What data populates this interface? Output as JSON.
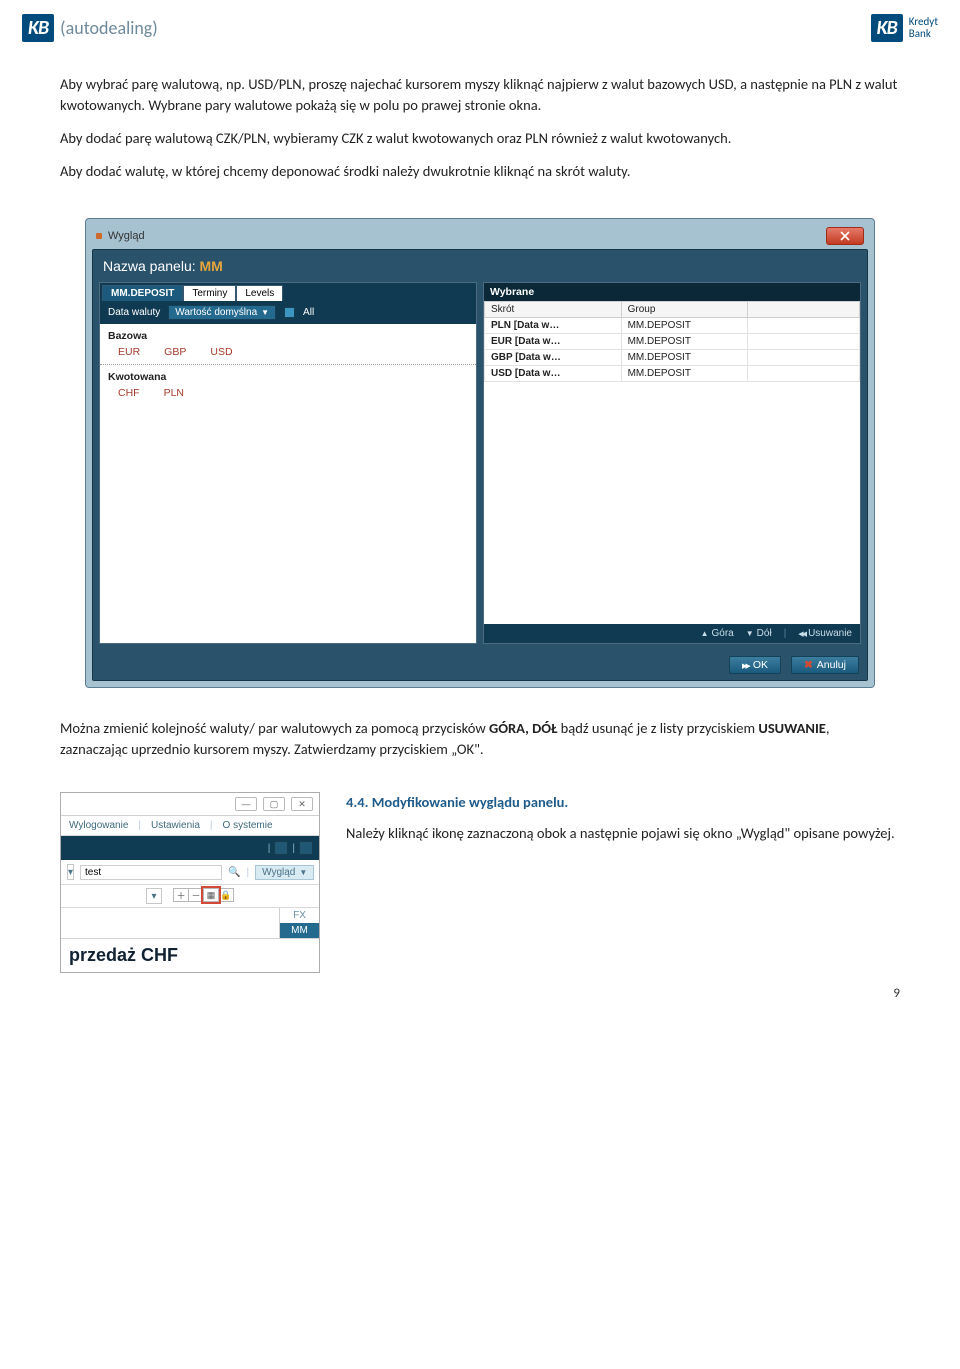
{
  "header": {
    "logo_left_kb": "KB",
    "logo_left_auto": "(autodealing)",
    "logo_right_kb": "KB",
    "logo_right_line1": "Kredyt",
    "logo_right_line2": "Bank"
  },
  "para1": "Aby wybrać parę walutową, np. USD/PLN, proszę najechać kursorem myszy kliknąć najpierw z walut bazowych USD, a następnie na PLN z walut kwotowanych. Wybrane pary walutowe pokażą się w polu po prawej stronie okna.",
  "para2": "Aby dodać parę walutową CZK/PLN, wybieramy CZK z walut kwotowanych oraz PLN również z walut kwotowanych.",
  "para3": "Aby dodać walutę, w której chcemy deponować środki należy dwukrotnie kliknąć na skrót waluty.",
  "dialog": {
    "title": "Wygląd",
    "panel_name_prefix": "Nazwa panelu:",
    "panel_name_value": "MM",
    "tabs": {
      "deposit": "MM.DEPOSIT",
      "terminy": "Terminy",
      "levels": "Levels"
    },
    "data_waluty_label": "Data waluty",
    "data_waluty_value": "Wartość domyślna",
    "all_label": "All",
    "bazowa_h": "Bazowa",
    "bazowa": {
      "c1": "EUR",
      "c2": "GBP",
      "c3": "USD"
    },
    "kwotowana_h": "Kwotowana",
    "kwotowana": {
      "c1": "CHF",
      "c2": "PLN"
    },
    "wybrane_h": "Wybrane",
    "cols": {
      "skrot": "Skrót",
      "group": "Group"
    },
    "rows": [
      {
        "skrot": "PLN [Data w…",
        "group": "MM.DEPOSIT"
      },
      {
        "skrot": "EUR [Data w…",
        "group": "MM.DEPOSIT"
      },
      {
        "skrot": "GBP [Data w…",
        "group": "MM.DEPOSIT"
      },
      {
        "skrot": "USD [Data w…",
        "group": "MM.DEPOSIT"
      }
    ],
    "btn_up": "Góra",
    "btn_down": "Dół",
    "btn_del": "Usuwanie",
    "btn_ok": "OK",
    "btn_cancel": "Anuluj"
  },
  "para4_a": "Można zmienić kolejność waluty/ par walutowych za pomocą przycisków ",
  "para4_gora_dol": "GÓRA, DÓŁ",
  "para4_b": " bądź usunąć je z listy przyciskiem ",
  "para4_usuwanie": "USUWANIE",
  "para4_c": ", zaznaczając uprzednio kursorem myszy. Zatwierdzamy przyciskiem „OK\".",
  "section44": {
    "heading": "4.4. Modyfikowanie wyglądu panelu.",
    "text": "Należy kliknąć ikonę zaznaczoną obok a następnie pojawi się okno „Wygląd\" opisane powyżej."
  },
  "small": {
    "menu": {
      "wylog": "Wylogowanie",
      "ust": "Ustawienia",
      "osys": "O systemie"
    },
    "test": "test",
    "wyglad": "Wygląd",
    "fx": "FX",
    "mm": "MM",
    "big": "przedaż CHF"
  },
  "page_number": "9"
}
